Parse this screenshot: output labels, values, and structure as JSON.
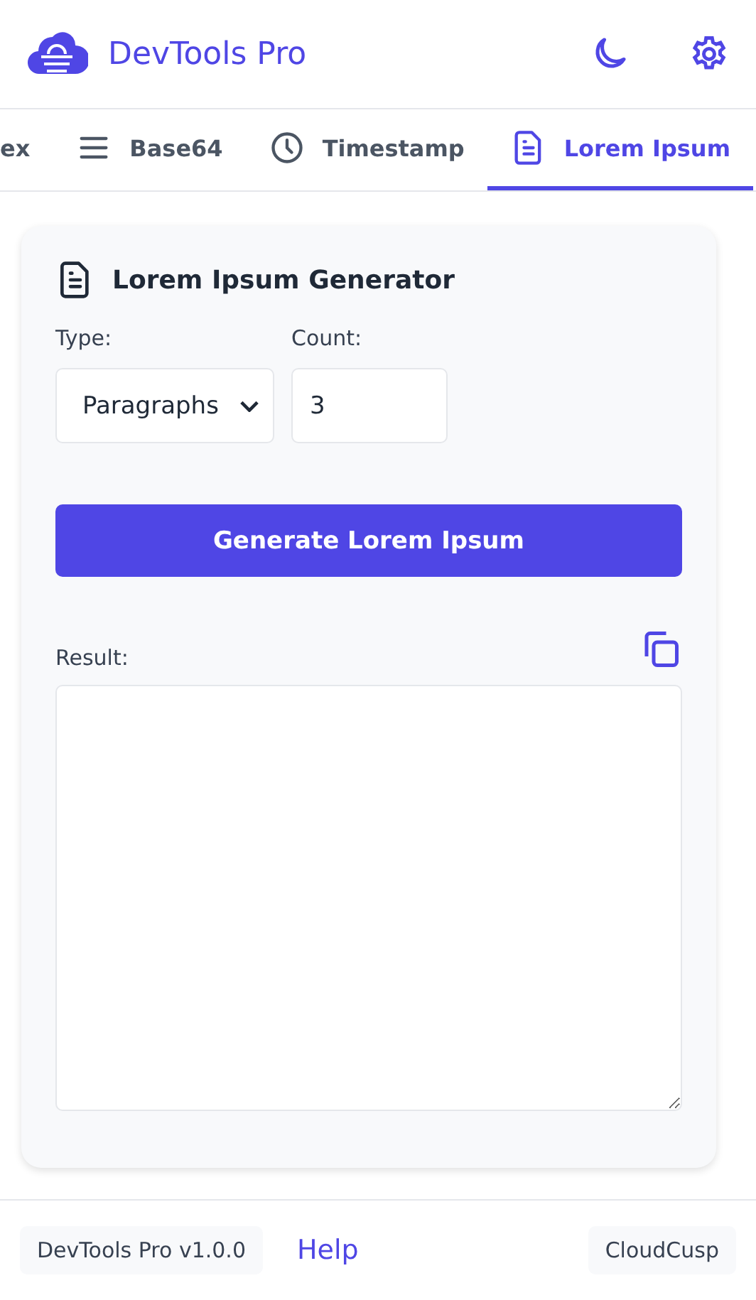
{
  "header": {
    "title": "DevTools Pro"
  },
  "tabs": [
    {
      "label": "ex",
      "kind": "plain",
      "selected": false
    },
    {
      "label": "Base64",
      "kind": "lines",
      "selected": false
    },
    {
      "label": "Timestamp",
      "kind": "clock",
      "selected": false
    },
    {
      "label": "Lorem Ipsum",
      "kind": "document",
      "selected": true
    }
  ],
  "card": {
    "title": "Lorem Ipsum Generator",
    "type_label": "Type:",
    "type_value": "Paragraphs",
    "count_label": "Count:",
    "count_value": "3",
    "generate_button": "Generate Lorem Ipsum",
    "result_label": "Result:"
  },
  "footer": {
    "version": "DevTools Pro v1.0.0",
    "help": "Help",
    "brand": "CloudCusp"
  }
}
